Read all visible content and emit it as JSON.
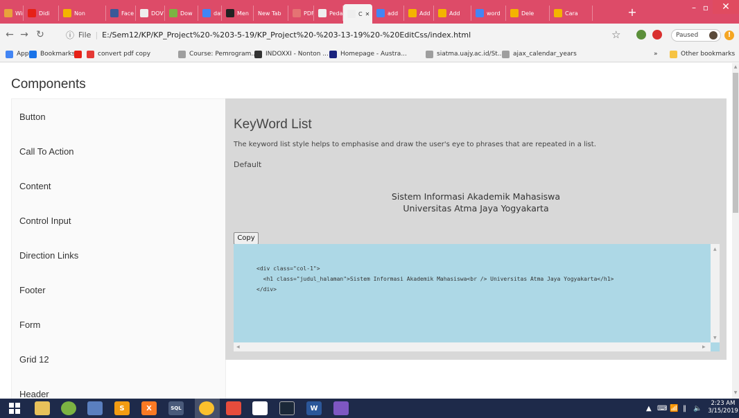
{
  "browser": {
    "tabs": [
      {
        "label": "Wind",
        "color": "#e9a23b",
        "icon": "windows-tab-icon"
      },
      {
        "label": "Didi",
        "color": "#e62117",
        "icon": "youtube-tab-icon"
      },
      {
        "label": "Non",
        "color": "#f4b400",
        "icon": "slack-tab-icon"
      },
      {
        "label": "Face",
        "color": "#3b5998",
        "icon": "facebook-tab-icon"
      },
      {
        "label": "DOV",
        "color": "#eeeeee",
        "icon": "document-tab-icon"
      },
      {
        "label": "Dow",
        "color": "#7cb342",
        "icon": "download-tab-icon"
      },
      {
        "label": "daft",
        "color": "#4285f4",
        "icon": "google-tab-icon"
      },
      {
        "label": "Men",
        "color": "#222222",
        "icon": "yahoo-tab-icon"
      },
      {
        "label": "New Tab",
        "color": "#dd4b68",
        "icon": ""
      },
      {
        "label": "PDF",
        "color": "#e57373",
        "icon": "pdf-tab-icon"
      },
      {
        "label": "Peda",
        "color": "#eeeeee",
        "icon": "document-tab-icon"
      },
      {
        "label": "C",
        "color": "#eeeeee",
        "icon": "document-tab-icon"
      },
      {
        "label": "add",
        "color": "#4285f4",
        "icon": "google-tab-icon"
      },
      {
        "label": "Add",
        "color": "#f4b400",
        "icon": "slack-tab-icon"
      },
      {
        "label": "Add",
        "color": "#f4b400",
        "icon": "slack-tab-icon"
      },
      {
        "label": "word",
        "color": "#4285f4",
        "icon": "google-tab-icon"
      },
      {
        "label": "Dele",
        "color": "#f4b400",
        "icon": "slack-tab-icon"
      },
      {
        "label": "Cara",
        "color": "#f4b400",
        "icon": "slack-tab-icon"
      }
    ],
    "address": {
      "scheme": "File",
      "url": "E:/Sem12/KP/KP_Project%20-%203-5-19/KP_Project%20-%203-13-19%20-%20EditCss/index.html"
    },
    "paused_label": "Paused",
    "bookmarks": [
      {
        "label": "Apps",
        "icon": "apps-grid-icon",
        "color": "#4285f4"
      },
      {
        "label": "Bookmarks",
        "icon": "star-bookmark-icon",
        "color": "#1a73e8"
      },
      {
        "label": "",
        "icon": "youtube-bookmark-icon",
        "color": "#e62117"
      },
      {
        "label": "convert pdf copy",
        "icon": "smallpdf-bookmark-icon",
        "color": "#e53935"
      },
      {
        "label": "Course: Pemrogram...",
        "icon": "page-bookmark-icon",
        "color": "#9e9e9e"
      },
      {
        "label": "INDOXXI - Nonton ...",
        "icon": "indoxxi-bookmark-icon",
        "color": "#333333"
      },
      {
        "label": "Homepage - Austra...",
        "icon": "homepage-bookmark-icon",
        "color": "#1a237e"
      },
      {
        "label": "siatma.uajy.ac.id/St...",
        "icon": "page-bookmark-icon",
        "color": "#9e9e9e"
      },
      {
        "label": "ajax_calendar_years",
        "icon": "page-bookmark-icon",
        "color": "#9e9e9e"
      }
    ],
    "more_label": "»",
    "other_bookmarks": "Other bookmarks"
  },
  "page": {
    "heading": "Components",
    "sidebar_items": [
      "Button",
      "Call To Action",
      "Content",
      "Control Input",
      "Direction Links",
      "Footer",
      "Form",
      "Grid 12",
      "Header"
    ],
    "panel": {
      "title": "KeyWord List",
      "description": "The keyword list style helps to emphasise and draw the user's eye to phrases that are repeated in a list.",
      "variant": "Default",
      "demo_line1": "Sistem Informasi Akademik Mahasiswa",
      "demo_line2": "Universitas Atma Jaya Yogyakarta",
      "copy_label": "Copy",
      "code_line1": "<div class=\"col-1\">",
      "code_line2": "  <h1 class=\"judul_halaman\">Sistem Informasi Akademik Mahasiswa<br /> Universitas Atma Jaya Yogyakarta</h1>",
      "code_line3": "</div>"
    }
  },
  "taskbar": {
    "clock_time": "2:23 AM",
    "clock_date": "3/15/2019"
  }
}
